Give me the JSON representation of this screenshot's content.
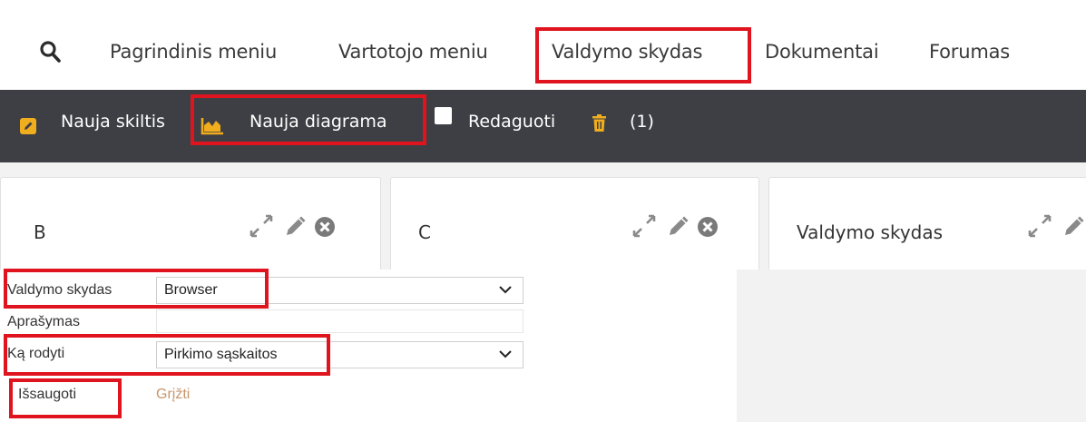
{
  "nav": {
    "items": [
      "Pagrindinis meniu",
      "Vartotojo meniu",
      "Valdymo skydas",
      "Dokumentai",
      "Forumas"
    ]
  },
  "toolbar": {
    "new_column": "Nauja skiltis",
    "new_chart": "Nauja diagrama",
    "edit": "Redaguoti",
    "count": "(1)",
    "edit_checked": false
  },
  "panels": [
    {
      "title": "B"
    },
    {
      "title": "C"
    },
    {
      "title": "Valdymo skydas"
    }
  ],
  "form": {
    "dashboard_label": "Valdymo skydas",
    "dashboard_value": "Browser",
    "description_label": "Aprašymas",
    "description_value": "",
    "show_label": "Ką rodyti",
    "show_value": "Pirkimo sąskaitos",
    "save_label": "Išsaugoti",
    "back_label": "Grįžti"
  },
  "colors": {
    "toolbar_bg": "#3d3f44",
    "accent_orange": "#f0ad1e",
    "highlight_red": "#e0141e",
    "back_link": "#c8956a"
  }
}
